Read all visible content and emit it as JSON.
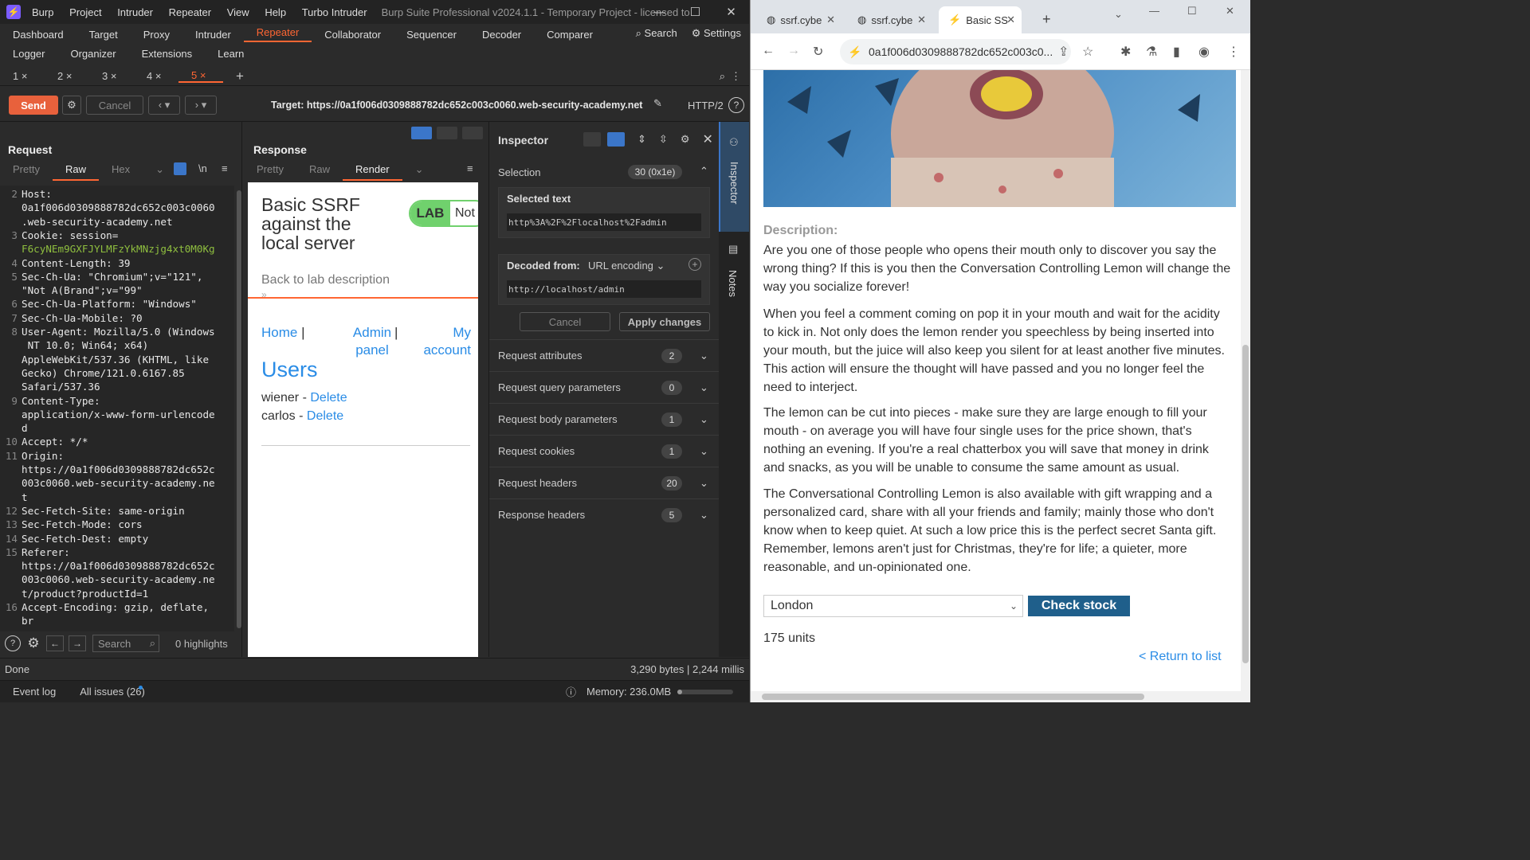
{
  "burp": {
    "title": "Burp Suite Professional v2024.1.1 - Temporary Project - licensed to",
    "menu": [
      "Burp",
      "Project",
      "Intruder",
      "Repeater",
      "View",
      "Help",
      "Turbo Intruder"
    ],
    "nav1": [
      "Dashboard",
      "Target",
      "Proxy",
      "Intruder",
      "Repeater",
      "Collaborator",
      "Sequencer",
      "Decoder",
      "Comparer"
    ],
    "nav2": [
      "Logger",
      "Organizer",
      "Extensions",
      "Learn"
    ],
    "search": "Search",
    "settings": "Settings",
    "subtabs": [
      "1 ×",
      "2 ×",
      "3 ×",
      "4 ×",
      "5 ×"
    ],
    "send": "Send",
    "cancel": "Cancel",
    "target": "Target: https://0a1f006d0309888782dc652c003c0060.web-security-academy.net",
    "http": "HTTP/2",
    "request": {
      "title": "Request",
      "tabs": [
        "Pretty",
        "Raw",
        "Hex"
      ],
      "lines": [
        {
          "n": "2",
          "t": "Host:"
        },
        {
          "n": "",
          "t": "0a1f006d0309888782dc652c003c0060"
        },
        {
          "n": "",
          "t": ".web-security-academy.net"
        },
        {
          "n": "3",
          "t": "Cookie: session="
        },
        {
          "n": "",
          "t": "F6cyNEm9GXFJYLMFzYkMNzjg4xt0M0Kg",
          "g": true
        },
        {
          "n": "4",
          "t": "Content-Length: 39"
        },
        {
          "n": "5",
          "t": "Sec-Ch-Ua: \"Chromium\";v=\"121\","
        },
        {
          "n": "",
          "t": "\"Not A(Brand\";v=\"99\""
        },
        {
          "n": "6",
          "t": "Sec-Ch-Ua-Platform: \"Windows\""
        },
        {
          "n": "7",
          "t": "Sec-Ch-Ua-Mobile: ?0"
        },
        {
          "n": "8",
          "t": "User-Agent: Mozilla/5.0 (Windows"
        },
        {
          "n": "",
          "t": " NT 10.0; Win64; x64)"
        },
        {
          "n": "",
          "t": "AppleWebKit/537.36 (KHTML, like"
        },
        {
          "n": "",
          "t": "Gecko) Chrome/121.0.6167.85"
        },
        {
          "n": "",
          "t": "Safari/537.36"
        },
        {
          "n": "9",
          "t": "Content-Type:"
        },
        {
          "n": "",
          "t": "application/x-www-form-urlencode"
        },
        {
          "n": "",
          "t": "d"
        },
        {
          "n": "10",
          "t": "Accept: */*"
        },
        {
          "n": "11",
          "t": "Origin:"
        },
        {
          "n": "",
          "t": "https://0a1f006d0309888782dc652c"
        },
        {
          "n": "",
          "t": "003c0060.web-security-academy.ne"
        },
        {
          "n": "",
          "t": "t"
        },
        {
          "n": "12",
          "t": "Sec-Fetch-Site: same-origin"
        },
        {
          "n": "13",
          "t": "Sec-Fetch-Mode: cors"
        },
        {
          "n": "14",
          "t": "Sec-Fetch-Dest: empty"
        },
        {
          "n": "15",
          "t": "Referer:"
        },
        {
          "n": "",
          "t": "https://0a1f006d0309888782dc652c"
        },
        {
          "n": "",
          "t": "003c0060.web-security-academy.ne"
        },
        {
          "n": "",
          "t": "t/product?productId=1"
        },
        {
          "n": "16",
          "t": "Accept-Encoding: gzip, deflate,"
        },
        {
          "n": "",
          "t": "br"
        }
      ],
      "search_placeholder": "Search",
      "highlights": "0 highlights"
    },
    "response": {
      "title": "Response",
      "tabs": [
        "Pretty",
        "Raw",
        "Render"
      ],
      "render": {
        "title": "Basic SSRF against the local server",
        "lab": "LAB",
        "not": "Not",
        "back": "Back to lab description",
        "nav_home": "Home",
        "nav_admin": "Admin panel",
        "nav_account": "My account",
        "users": "Users",
        "user1": "wiener",
        "user2": "carlos",
        "delete": "Delete"
      }
    },
    "inspector": {
      "title": "Inspector",
      "selection": "Selection",
      "selection_count": "30 (0x1e)",
      "selected_text_label": "Selected text",
      "selected_text": "http%3A%2F%2Flocalhost%2Fadmin",
      "decoded_from_label": "Decoded from:",
      "decoded_from": "URL encoding",
      "decoded": "http://localhost/admin",
      "cancel": "Cancel",
      "apply": "Apply changes",
      "rows": [
        {
          "label": "Request attributes",
          "count": "2"
        },
        {
          "label": "Request query parameters",
          "count": "0"
        },
        {
          "label": "Request body parameters",
          "count": "1"
        },
        {
          "label": "Request cookies",
          "count": "1"
        },
        {
          "label": "Request headers",
          "count": "20"
        },
        {
          "label": "Response headers",
          "count": "5"
        }
      ]
    },
    "dock": {
      "inspector": "Inspector",
      "notes": "Notes"
    },
    "status": {
      "left": "Done",
      "right": "3,290 bytes | 2,244 millis"
    },
    "bottom": {
      "event_log": "Event log",
      "issues": "All issues (26)",
      "memory": "Memory: 236.0MB"
    }
  },
  "chrome": {
    "tabs": [
      "ssrf.cybe",
      "ssrf.cybe",
      "Basic SS"
    ],
    "url": "0a1f006d0309888782dc652c003c0...",
    "desc_heading": "Description:",
    "paragraphs": [
      "Are you one of those people who opens their mouth only to discover you say the wrong thing? If this is you then the Conversation Controlling Lemon will change the way you socialize forever!",
      "When you feel a comment coming on pop it in your mouth and wait for the acidity to kick in. Not only does the lemon render you speechless by being inserted into your mouth, but the juice will also keep you silent for at least another five minutes. This action will ensure the thought will have passed and you no longer feel the need to interject.",
      "The lemon can be cut into pieces - make sure they are large enough to fill your mouth - on average you will have four single uses for the price shown, that's nothing an evening. If you're a real chatterbox you will save that money in drink and snacks, as you will be unable to consume the same amount as usual.",
      "The Conversational Controlling Lemon is also available with gift wrapping and a personalized card, share with all your friends and family; mainly those who don't know when to keep quiet. At such a low price this is the perfect secret Santa gift. Remember, lemons aren't just for Christmas, they're for life; a quieter, more reasonable, and un-opinionated one."
    ],
    "location": "London",
    "check_stock": "Check stock",
    "units": "175 units",
    "return": "< Return to list"
  },
  "colors": {
    "accent": "#ff6633",
    "send": "#e8613c",
    "link": "#2a8ce6",
    "check": "#1f5f8b",
    "lab": "#70d16d"
  }
}
